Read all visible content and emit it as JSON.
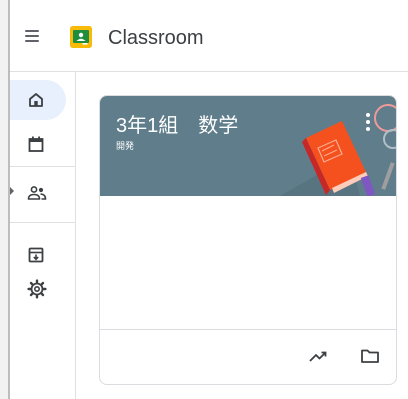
{
  "app": {
    "title": "Classroom",
    "brand_color": "#f9bb0a"
  },
  "topbar": {
    "menu_icon": "hamburger-menu-icon",
    "logo_icon": "classroom-logo-icon"
  },
  "sidebar": {
    "items": [
      {
        "name": "home",
        "icon": "home-icon",
        "active": true
      },
      {
        "name": "calendar",
        "icon": "calendar-icon",
        "active": false
      },
      {
        "name": "enrolled",
        "icon": "people-icon",
        "active": false
      },
      {
        "name": "archived",
        "icon": "archive-icon",
        "active": false
      },
      {
        "name": "settings",
        "icon": "gear-icon",
        "active": false
      }
    ]
  },
  "card": {
    "title": "3年1組　数学",
    "subtitle": "開発",
    "header_color": "#607d8b",
    "illustration": "book-illustration",
    "more_icon": "more-vert-icon",
    "footer_icons": [
      "trending-up-icon",
      "folder-icon"
    ]
  }
}
